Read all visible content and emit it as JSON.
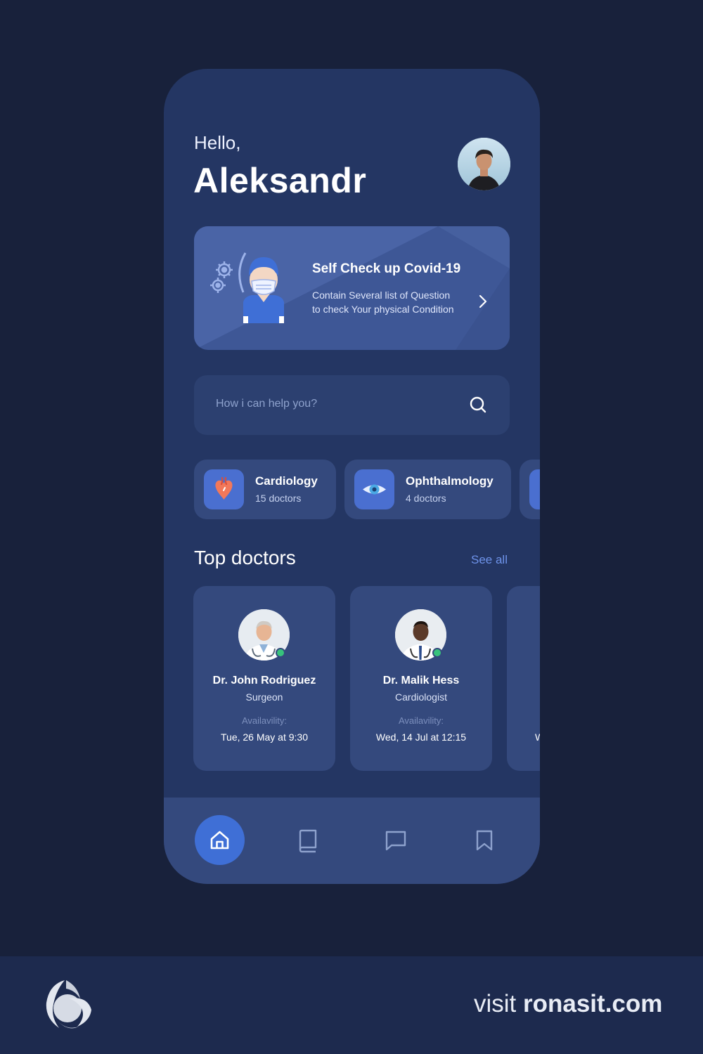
{
  "header": {
    "greeting": "Hello,",
    "username": "Aleksandr"
  },
  "covid_card": {
    "title": "Self Check up Covid-19",
    "description_line1": "Contain Several list of Question",
    "description_line2": "to check Your physical Condition",
    "illustration_icon": "masked-doctor-virus-illustration",
    "arrow_icon": "chevron-right-icon"
  },
  "search": {
    "placeholder": "How i can help you?",
    "icon": "search-icon"
  },
  "specialties": [
    {
      "name": "Cardiology",
      "count": "15 doctors",
      "icon": "heart-icon"
    },
    {
      "name": "Ophthalmology",
      "count": "4 doctors",
      "icon": "eye-icon"
    }
  ],
  "top_doctors": {
    "title": "Top doctors",
    "see_all": "See all",
    "doctors": [
      {
        "name": "Dr. John Rodriguez",
        "specialty": "Surgeon",
        "availability_label": "Availavility:",
        "availability": "Tue, 26 May at 9:30",
        "online": true
      },
      {
        "name": "Dr. Malik Hess",
        "specialty": "Cardiologist",
        "availability_label": "Availavility:",
        "availability": "Wed, 14 Jul at 12:15",
        "online": true
      },
      {
        "partial_text": "W"
      }
    ]
  },
  "bottom_nav": {
    "items": [
      {
        "icon": "home-icon",
        "active": true
      },
      {
        "icon": "book-icon",
        "active": false
      },
      {
        "icon": "chat-icon",
        "active": false
      },
      {
        "icon": "bookmark-icon",
        "active": false
      }
    ]
  },
  "footer": {
    "prefix": "visit ",
    "domain": "ronasit.com",
    "logo": "ronas-it-logo-icon"
  },
  "colors": {
    "background": "#18213b",
    "phone": "#243663",
    "card": "#34497d",
    "accent": "#3f6fd6",
    "link": "#6e93ea",
    "online": "#37c27c"
  }
}
